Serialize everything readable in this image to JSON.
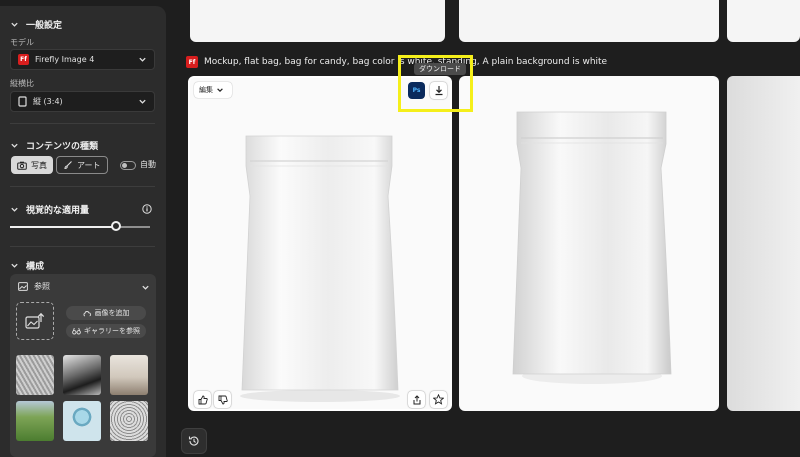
{
  "sidebar": {
    "general": {
      "title": "一般設定"
    },
    "model": {
      "label": "モデル",
      "value": "Firefly Image 4",
      "badge": "Ff"
    },
    "aspect": {
      "label": "縦横比",
      "value": "縦 (3:4)"
    },
    "content_type": {
      "title": "コンテンツの種類",
      "photo": "写真",
      "art": "アート",
      "auto": "自動"
    },
    "visual_intensity": {
      "title": "視覚的な適用量",
      "value_fraction": 0.76
    },
    "composition": {
      "title": "構成",
      "reference": "参照",
      "add_image": "画像を追加",
      "browse_gallery": "ギャラリーを参照",
      "thumbnails": [
        "thumb-sketch-bird",
        "thumb-bw-landscape",
        "thumb-interior",
        "thumb-green-road",
        "thumb-blue-sphere",
        "thumb-owl-sketch"
      ]
    }
  },
  "main": {
    "prompt": "Mockup, flat bag, bag for candy, bag color is white, standing, A plain background is white",
    "prompt_badge": "Ff",
    "card": {
      "edit_label": "編集",
      "ps_label": "Ps",
      "tooltip": "ダウンロード"
    }
  },
  "colors": {
    "accent_red": "#d81e1e",
    "highlight": "#f5ef1a",
    "background": "#1e1e1e",
    "panel": "#2c2c2c"
  }
}
